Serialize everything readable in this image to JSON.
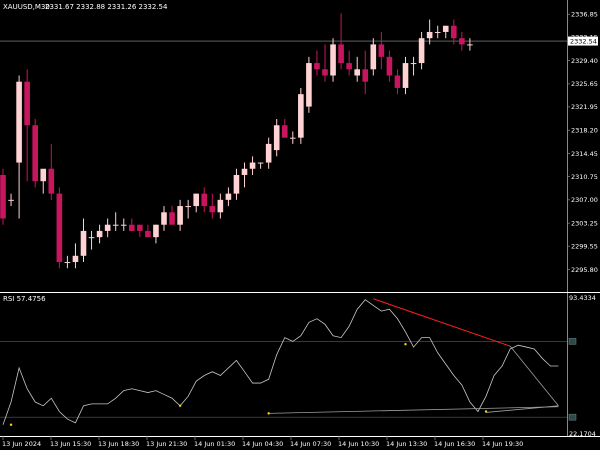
{
  "window": {
    "symbol_label": "XAUUSD,M30",
    "ohlc_label": "2331.67 2332.88 2331.26 2332.54",
    "current_price_tag": "2332.54",
    "rsi_label": "RSI 57.4756",
    "rsi_max_label": "93.4334",
    "rsi_min_label": "22.1704"
  },
  "colors": {
    "background": "#000000",
    "bull": "#ffd3d3",
    "bear": "#c7155e",
    "grid": "#ffffff",
    "rsi_line": "#c8c8c8",
    "trend_red": "#ff2020",
    "trend_gray": "#9aa29a",
    "point_yellow": "#ffd700"
  },
  "chart_data": {
    "type": "candlestick",
    "timeframe": "M30",
    "x_tick_labels": [
      "13 Jun 2024",
      "13 Jun 15:30",
      "13 Jun 18:30",
      "13 Jun 21:30",
      "14 Jun 01:30",
      "14 Jun 04:30",
      "14 Jun 07:30",
      "14 Jun 10:30",
      "14 Jun 13:30",
      "14 Jun 16:30",
      "14 Jun 19:30"
    ],
    "price_axis": {
      "ylim": [
        2292.5,
        2338.5
      ],
      "tick_labels": [
        "2336.85",
        "2333.15",
        "2329.40",
        "2325.65",
        "2321.95",
        "2318.20",
        "2314.45",
        "2310.75",
        "2307.00",
        "2303.25",
        "2299.55",
        "2295.80"
      ],
      "horizontal_line": 2332.54
    },
    "candles": [
      {
        "o": 2311,
        "h": 2312,
        "l": 2303,
        "c": 2304
      },
      {
        "o": 2307,
        "h": 2308,
        "l": 2306,
        "c": 2307
      },
      {
        "o": 2313,
        "h": 2327,
        "l": 2304,
        "c": 2326
      },
      {
        "o": 2326,
        "h": 2328,
        "l": 2310,
        "c": 2319
      },
      {
        "o": 2319,
        "h": 2320,
        "l": 2309,
        "c": 2310
      },
      {
        "o": 2310,
        "h": 2311,
        "l": 2308,
        "c": 2312
      },
      {
        "o": 2312,
        "h": 2316,
        "l": 2307,
        "c": 2308
      },
      {
        "o": 2308,
        "h": 2309,
        "l": 2296,
        "c": 2297
      },
      {
        "o": 2297,
        "h": 2298,
        "l": 2296,
        "c": 2297
      },
      {
        "o": 2297,
        "h": 2300,
        "l": 2296,
        "c": 2298
      },
      {
        "o": 2298,
        "h": 2304,
        "l": 2297,
        "c": 2302
      },
      {
        "o": 2301,
        "h": 2302,
        "l": 2299,
        "c": 2301
      },
      {
        "o": 2301,
        "h": 2303,
        "l": 2300,
        "c": 2302
      },
      {
        "o": 2302,
        "h": 2304,
        "l": 2301,
        "c": 2303
      },
      {
        "o": 2303,
        "h": 2305,
        "l": 2302,
        "c": 2303
      },
      {
        "o": 2303,
        "h": 2304,
        "l": 2302,
        "c": 2303
      },
      {
        "o": 2303,
        "h": 2304,
        "l": 2302,
        "c": 2302
      },
      {
        "o": 2303,
        "h": 2303,
        "l": 2301,
        "c": 2302
      },
      {
        "o": 2302,
        "h": 2303,
        "l": 2301,
        "c": 2301
      },
      {
        "o": 2301,
        "h": 2303,
        "l": 2300,
        "c": 2303
      },
      {
        "o": 2303,
        "h": 2306,
        "l": 2302,
        "c": 2305
      },
      {
        "o": 2305,
        "h": 2306,
        "l": 2303,
        "c": 2303
      },
      {
        "o": 2303,
        "h": 2307,
        "l": 2302,
        "c": 2306
      },
      {
        "o": 2306,
        "h": 2307,
        "l": 2304,
        "c": 2306
      },
      {
        "o": 2306,
        "h": 2308,
        "l": 2305,
        "c": 2308
      },
      {
        "o": 2308,
        "h": 2309,
        "l": 2305,
        "c": 2306
      },
      {
        "o": 2306,
        "h": 2308,
        "l": 2304,
        "c": 2305
      },
      {
        "o": 2305,
        "h": 2308,
        "l": 2304,
        "c": 2307
      },
      {
        "o": 2307,
        "h": 2309,
        "l": 2306,
        "c": 2308
      },
      {
        "o": 2308,
        "h": 2312,
        "l": 2307,
        "c": 2311
      },
      {
        "o": 2311,
        "h": 2313,
        "l": 2309,
        "c": 2312
      },
      {
        "o": 2312,
        "h": 2314,
        "l": 2311,
        "c": 2313
      },
      {
        "o": 2313,
        "h": 2313,
        "l": 2312,
        "c": 2313
      },
      {
        "o": 2313,
        "h": 2317,
        "l": 2312,
        "c": 2316
      },
      {
        "o": 2315,
        "h": 2320,
        "l": 2314,
        "c": 2319
      },
      {
        "o": 2319,
        "h": 2320,
        "l": 2317,
        "c": 2317
      },
      {
        "o": 2317,
        "h": 2318,
        "l": 2316,
        "c": 2317
      },
      {
        "o": 2317,
        "h": 2325,
        "l": 2316,
        "c": 2324
      },
      {
        "o": 2322,
        "h": 2330,
        "l": 2321,
        "c": 2329
      },
      {
        "o": 2329,
        "h": 2331,
        "l": 2327,
        "c": 2328
      },
      {
        "o": 2328,
        "h": 2332,
        "l": 2326,
        "c": 2327
      },
      {
        "o": 2327,
        "h": 2333,
        "l": 2326,
        "c": 2332
      },
      {
        "o": 2332,
        "h": 2337,
        "l": 2328,
        "c": 2329
      },
      {
        "o": 2329,
        "h": 2331,
        "l": 2327,
        "c": 2328
      },
      {
        "o": 2327,
        "h": 2330,
        "l": 2326,
        "c": 2328
      },
      {
        "o": 2328,
        "h": 2331,
        "l": 2324,
        "c": 2326
      },
      {
        "o": 2328,
        "h": 2333,
        "l": 2327,
        "c": 2332
      },
      {
        "o": 2332,
        "h": 2334,
        "l": 2328,
        "c": 2330
      },
      {
        "o": 2330,
        "h": 2331,
        "l": 2326,
        "c": 2327
      },
      {
        "o": 2327,
        "h": 2328,
        "l": 2324,
        "c": 2325
      },
      {
        "o": 2325,
        "h": 2330,
        "l": 2324,
        "c": 2329
      },
      {
        "o": 2329,
        "h": 2330,
        "l": 2327,
        "c": 2329
      },
      {
        "o": 2329,
        "h": 2334,
        "l": 2328,
        "c": 2333
      },
      {
        "o": 2333,
        "h": 2336,
        "l": 2332,
        "c": 2334
      },
      {
        "o": 2334,
        "h": 2335,
        "l": 2333,
        "c": 2334
      },
      {
        "o": 2334,
        "h": 2335,
        "l": 2333,
        "c": 2335
      },
      {
        "o": 2335,
        "h": 2336,
        "l": 2332,
        "c": 2333
      },
      {
        "o": 2333,
        "h": 2334,
        "l": 2331,
        "c": 2332
      },
      {
        "o": 2332,
        "h": 2333,
        "l": 2331,
        "c": 2332
      }
    ],
    "rsi": {
      "ylim": [
        22.1704,
        93.4334
      ],
      "levels": [
        70,
        30
      ],
      "values": [
        26,
        38,
        56,
        45,
        38,
        36,
        40,
        33,
        29,
        27,
        36,
        37,
        37,
        37,
        40,
        44,
        45,
        44,
        43,
        44,
        42,
        40,
        36,
        41,
        49,
        52,
        54,
        52,
        56,
        60,
        54,
        48,
        48,
        50,
        63,
        72,
        70,
        73,
        80,
        82,
        79,
        73,
        72,
        78,
        87,
        92,
        89,
        86,
        87,
        82,
        75,
        67,
        72,
        72,
        64,
        58,
        52,
        47,
        38,
        33,
        41,
        52,
        57,
        66,
        68,
        67,
        66,
        61,
        57,
        57
      ],
      "red_trendline": {
        "from": [
          46,
          92.5
        ],
        "to": [
          63,
          67.5
        ]
      },
      "gray_trendlines": [
        {
          "from": [
            33,
            32
          ],
          "to": [
            69,
            35.5
          ]
        },
        {
          "from": [
            60,
            32.5
          ],
          "to": [
            69,
            36
          ]
        },
        {
          "from": [
            63,
            67.5
          ],
          "to": [
            69,
            36
          ]
        }
      ],
      "marked_points": [
        [
          1,
          26
        ],
        [
          22,
          36
        ],
        [
          33,
          32
        ],
        [
          50,
          68.5
        ],
        [
          60,
          33
        ]
      ]
    }
  }
}
